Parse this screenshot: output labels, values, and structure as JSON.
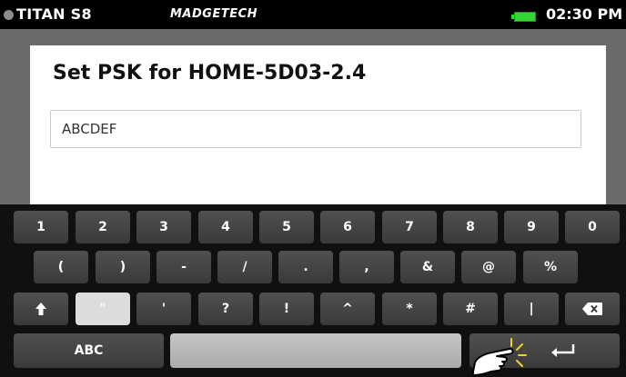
{
  "status_bar": {
    "device_name": "TITAN S8",
    "brand": "MADGETECH",
    "time": "02:30 PM",
    "battery_color": "#33d633"
  },
  "dialog": {
    "title": "Set PSK for HOME-5D03-2.4",
    "input_value": "ABCDEF"
  },
  "keyboard": {
    "row1": [
      "1",
      "2",
      "3",
      "4",
      "5",
      "6",
      "7",
      "8",
      "9",
      "0"
    ],
    "row2": [
      "(",
      ")",
      "-",
      "/",
      ".",
      ",",
      "&",
      "@",
      "%"
    ],
    "row3": [
      "\"",
      "'",
      "?",
      "!",
      "^",
      "*",
      "#",
      "|"
    ],
    "shift_icon": "shift-arrow-icon",
    "backspace_icon": "backspace-icon",
    "mode_label": "ABC",
    "enter_icon": "enter-arrow-icon",
    "pointer_icon": "hand-pointer-icon"
  }
}
